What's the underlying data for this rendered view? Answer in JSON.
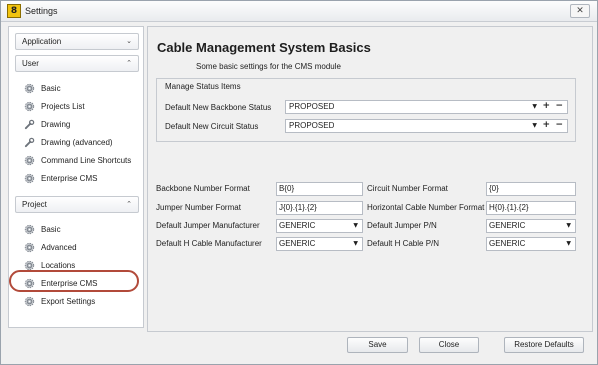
{
  "window": {
    "title": "Settings",
    "app_icon_glyph": "8",
    "close_glyph": "✕"
  },
  "sidebar": {
    "application_header": "Application",
    "user_header": "User",
    "user_items": [
      {
        "label": "Basic",
        "icon": "gear-icon"
      },
      {
        "label": "Projects List",
        "icon": "gear-icon"
      },
      {
        "label": "Drawing",
        "icon": "wrench-icon"
      },
      {
        "label": "Drawing (advanced)",
        "icon": "wrench-icon"
      },
      {
        "label": "Command Line Shortcuts",
        "icon": "gear-icon"
      },
      {
        "label": "Enterprise CMS",
        "icon": "gear-icon"
      }
    ],
    "project_header": "Project",
    "project_items": [
      {
        "label": "Basic",
        "icon": "gear-icon"
      },
      {
        "label": "Advanced",
        "icon": "gear-icon"
      },
      {
        "label": "Locations",
        "icon": "gear-icon"
      },
      {
        "label": "Enterprise CMS",
        "icon": "gear-icon",
        "highlighted": true
      },
      {
        "label": "Export Settings",
        "icon": "gear-icon"
      }
    ],
    "chevron_down": "⌄",
    "chevron_up": "⌃"
  },
  "main": {
    "title": "Cable Management System Basics",
    "subtitle": "Some basic settings for the CMS module",
    "status_group": {
      "title": "Manage Status Items",
      "backbone_label": "Default New Backbone Status",
      "backbone_value": "PROPOSED",
      "circuit_label": "Default New Circuit Status",
      "circuit_value": "PROPOSED"
    },
    "fields": {
      "backbone_format_label": "Backbone Number Format",
      "backbone_format_value": "B{0}",
      "circuit_format_label": "Circuit Number Format",
      "circuit_format_value": "{0}",
      "jumper_format_label": "Jumper Number Format",
      "jumper_format_value": "J{0}.{1}.{2}",
      "hcable_format_label": "Horizontal Cable Number Format",
      "hcable_format_value": "H{0}.{1}.{2}",
      "jumper_mfr_label": "Default Jumper Manufacturer",
      "jumper_mfr_value": "GENERIC",
      "jumper_pn_label": "Default Jumper P/N",
      "jumper_pn_value": "GENERIC",
      "hcable_mfr_label": "Default H Cable Manufacturer",
      "hcable_mfr_value": "GENERIC",
      "hcable_pn_label": "Default H Cable P/N",
      "hcable_pn_value": "GENERIC"
    }
  },
  "footer": {
    "save": "Save",
    "close": "Close",
    "restore": "Restore Defaults"
  },
  "colors": {
    "highlight_ring": "#b24a3a",
    "accent_icon": "#f2c40f"
  }
}
